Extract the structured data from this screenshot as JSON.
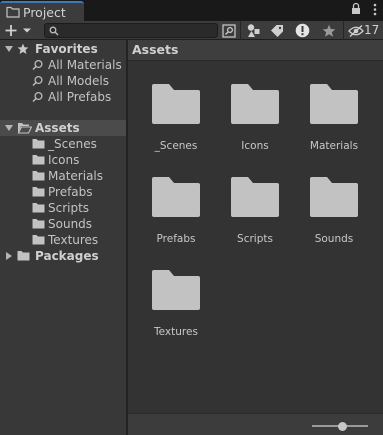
{
  "window": {
    "tab_label": "Project"
  },
  "toolbar": {
    "search": {
      "value": "",
      "placeholder": ""
    },
    "hidden_count": "17"
  },
  "tree": {
    "favorites": {
      "label": "Favorites",
      "items": [
        "All Materials",
        "All Models",
        "All Prefabs"
      ]
    },
    "assets": {
      "label": "Assets",
      "children": [
        "_Scenes",
        "Icons",
        "Materials",
        "Prefabs",
        "Scripts",
        "Sounds",
        "Textures"
      ]
    },
    "packages": {
      "label": "Packages"
    }
  },
  "grid": {
    "breadcrumb": "Assets",
    "items": [
      "_Scenes",
      "Icons",
      "Materials",
      "Prefabs",
      "Scripts",
      "Sounds",
      "Textures"
    ]
  },
  "zoom": {
    "level": 0.55
  },
  "colors": {
    "accent": "#3a79bb",
    "folder": "#c2c2c2",
    "warning": "#e5e5e5"
  }
}
